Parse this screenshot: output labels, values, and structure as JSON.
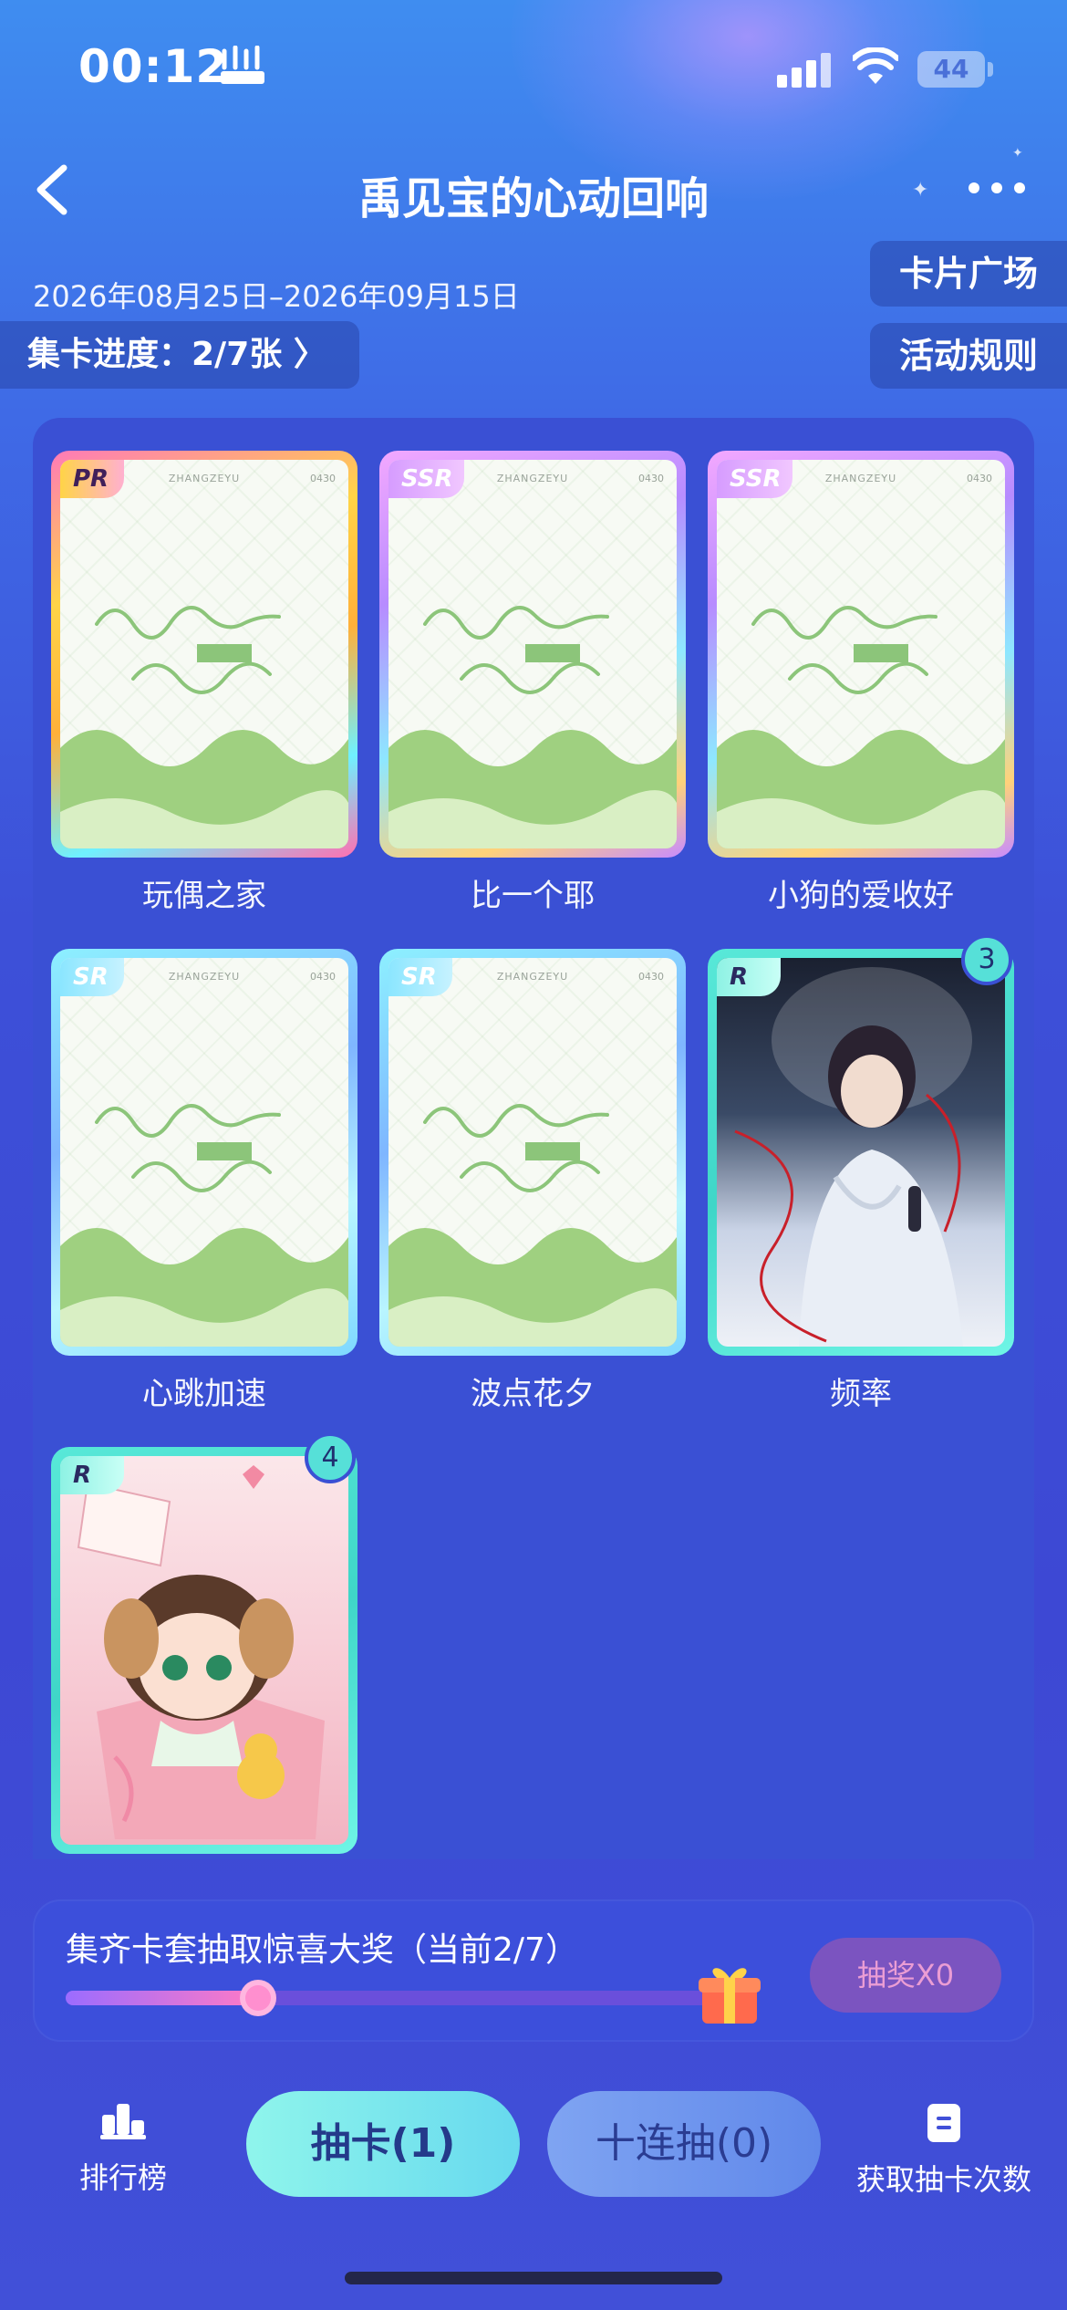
{
  "status_bar": {
    "time": "00:12",
    "indicator": "📶",
    "battery": "44"
  },
  "nav": {
    "title": "禹见宝的心动回响"
  },
  "event": {
    "date_range": "2026年08月25日–2026年09月15日",
    "progress_label": "集卡进度：2/7张 〉",
    "card_square_label": "卡片广场",
    "rules_label": "活动规则"
  },
  "card_art": {
    "brand": "ZHANGZEYU",
    "serial": "0430"
  },
  "cards": [
    {
      "rarity": "PR",
      "name": "玩偶之家"
    },
    {
      "rarity": "SSR",
      "name": "比一个耶"
    },
    {
      "rarity": "SSR",
      "name": "小狗的爱收好"
    },
    {
      "rarity": "SR",
      "name": "心跳加速"
    },
    {
      "rarity": "SR",
      "name": "波点花夕"
    },
    {
      "rarity": "R",
      "name": "频率",
      "count": "3"
    },
    {
      "rarity": "R",
      "name": "",
      "count": "4"
    }
  ],
  "collect": {
    "title": "集齐卡套抽取惊喜大奖（当前2/7）",
    "progress_fraction": 0.2857,
    "prize_button": "抽奖X0"
  },
  "bottom": {
    "ranking_label": "排行榜",
    "draw_label": "抽卡(1)",
    "ten_draw_label": "十连抽(0)",
    "get_draws_label": "获取抽卡次数"
  },
  "colors": {
    "accent": "#8ff5ec",
    "panel": "#3a50d4",
    "badge": "#56e0d8"
  }
}
